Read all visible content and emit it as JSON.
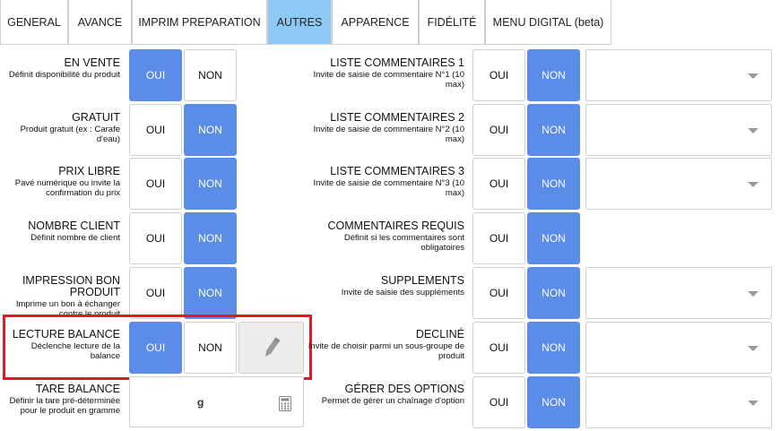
{
  "tabs": [
    {
      "label": "GENERAL"
    },
    {
      "label": "AVANCE"
    },
    {
      "label": "IMPRIM PREPARATION"
    },
    {
      "label": "AUTRES",
      "active": true
    },
    {
      "label": "APPARENCE"
    },
    {
      "label": "FIDÉLITÉ"
    },
    {
      "label": "MENU DIGITAL (beta)"
    }
  ],
  "buttons": {
    "oui": "OUI",
    "non": "NON"
  },
  "left_rows": [
    {
      "title": "EN VENTE",
      "desc": "Définit disponibilité du produit",
      "selected": "oui"
    },
    {
      "title": "GRATUIT",
      "desc": "Produit gratuit (ex : Carafe d'eau)",
      "selected": "non"
    },
    {
      "title": "PRIX LIBRE",
      "desc": "Pavé numérique ou invite la confirmation du prix",
      "selected": "non"
    },
    {
      "title": "NOMBRE CLIENT",
      "desc": "Définit nombre de client",
      "selected": "non"
    },
    {
      "title": "IMPRESSION BON PRODUIT",
      "desc": "Imprime un bon à échanger contre le produit",
      "selected": "non"
    },
    {
      "title": "LECTURE BALANCE",
      "desc": "Déclenche lecture de la balance",
      "selected": "oui"
    }
  ],
  "tare": {
    "title": "TARE BALANCE",
    "desc": "Définir la tare pré-déterminée pour le produit en gramme",
    "unit": "g"
  },
  "right_rows": [
    {
      "title": "LISTE COMMENTAIRES 1",
      "desc": "Invite de saisie de commentaire N°1 (10 max)",
      "selected": "non",
      "select": true
    },
    {
      "title": "LISTE COMMENTAIRES 2",
      "desc": "Invite de saisie de commentaire N°2 (10 max)",
      "selected": "non",
      "select": true
    },
    {
      "title": "LISTE COMMENTAIRES 3",
      "desc": "Invite de saisie de commentaire N°3 (10 max)",
      "selected": "non",
      "select": true
    },
    {
      "title": "COMMENTAIRES REQUIS",
      "desc": "Définit si les commentaires sont obligatoires",
      "selected": "non",
      "select": false
    },
    {
      "title": "SUPPLEMENTS",
      "desc": "Invite de saisie des suppléments",
      "selected": "non",
      "select": true
    },
    {
      "title": "DECLINÉ",
      "desc": "Invite de choisir parmi un sous-groupe de produit",
      "selected": "non",
      "select": true
    },
    {
      "title": "GÉRER DES OPTIONS",
      "desc": "Permet de gérer un chaînage d'option",
      "selected": "non",
      "select": true
    }
  ],
  "colors": {
    "accent": "#5b8de8",
    "active_tab": "#8ec9f5",
    "highlight": "#e8161e"
  },
  "icons": {
    "edit": "pencil-icon",
    "calculator": "calculator-icon",
    "dropdown": "caret-down-icon"
  }
}
